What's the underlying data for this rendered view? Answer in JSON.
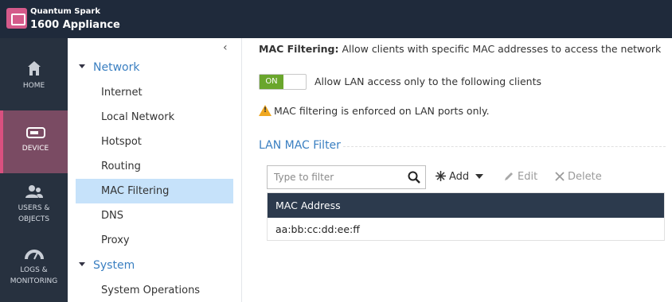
{
  "app": {
    "brand_line1": "Quantum Spark",
    "brand_line2": "1600 Appliance"
  },
  "rail": [
    {
      "label": "HOME",
      "icon": "home-icon"
    },
    {
      "label": "DEVICE",
      "icon": "device-icon",
      "active": true
    },
    {
      "label": "USERS &\nOBJECTS",
      "icon": "users-icon"
    },
    {
      "label": "LOGS &\nMONITORING",
      "icon": "gauge-icon"
    }
  ],
  "tree": {
    "collapse_glyph": "‹",
    "groups": [
      {
        "label": "Network"
      },
      {
        "label": "System"
      }
    ],
    "items": [
      {
        "label": "Internet"
      },
      {
        "label": "Local Network"
      },
      {
        "label": "Hotspot"
      },
      {
        "label": "Routing"
      },
      {
        "label": "MAC Filtering",
        "selected": true
      },
      {
        "label": "DNS"
      },
      {
        "label": "Proxy"
      },
      {
        "label": "System Operations"
      }
    ]
  },
  "main": {
    "heading_bold": "MAC Filtering:",
    "heading_text": " Allow clients with specific MAC addresses to access the network",
    "toggle_on_label": "ON",
    "toggle_label": "Allow LAN access only to the following clients",
    "warning": "MAC filtering is enforced on LAN ports only.",
    "section_title": "LAN MAC Filter",
    "filter_placeholder": "Type to filter",
    "toolbar": {
      "add": "Add",
      "edit": "Edit",
      "delete": "Delete"
    },
    "table": {
      "header": "MAC Address",
      "rows": [
        "aa:bb:cc:dd:ee:ff"
      ]
    }
  },
  "colors": {
    "topbar": "#1f2a3b",
    "rail": "#27313f",
    "rail_active": "#7a4b63",
    "accent_link": "#3a7fc1",
    "selected_row": "#c6e2fa",
    "toggle_on": "#6aa62c",
    "table_header": "#2c3a4d"
  }
}
